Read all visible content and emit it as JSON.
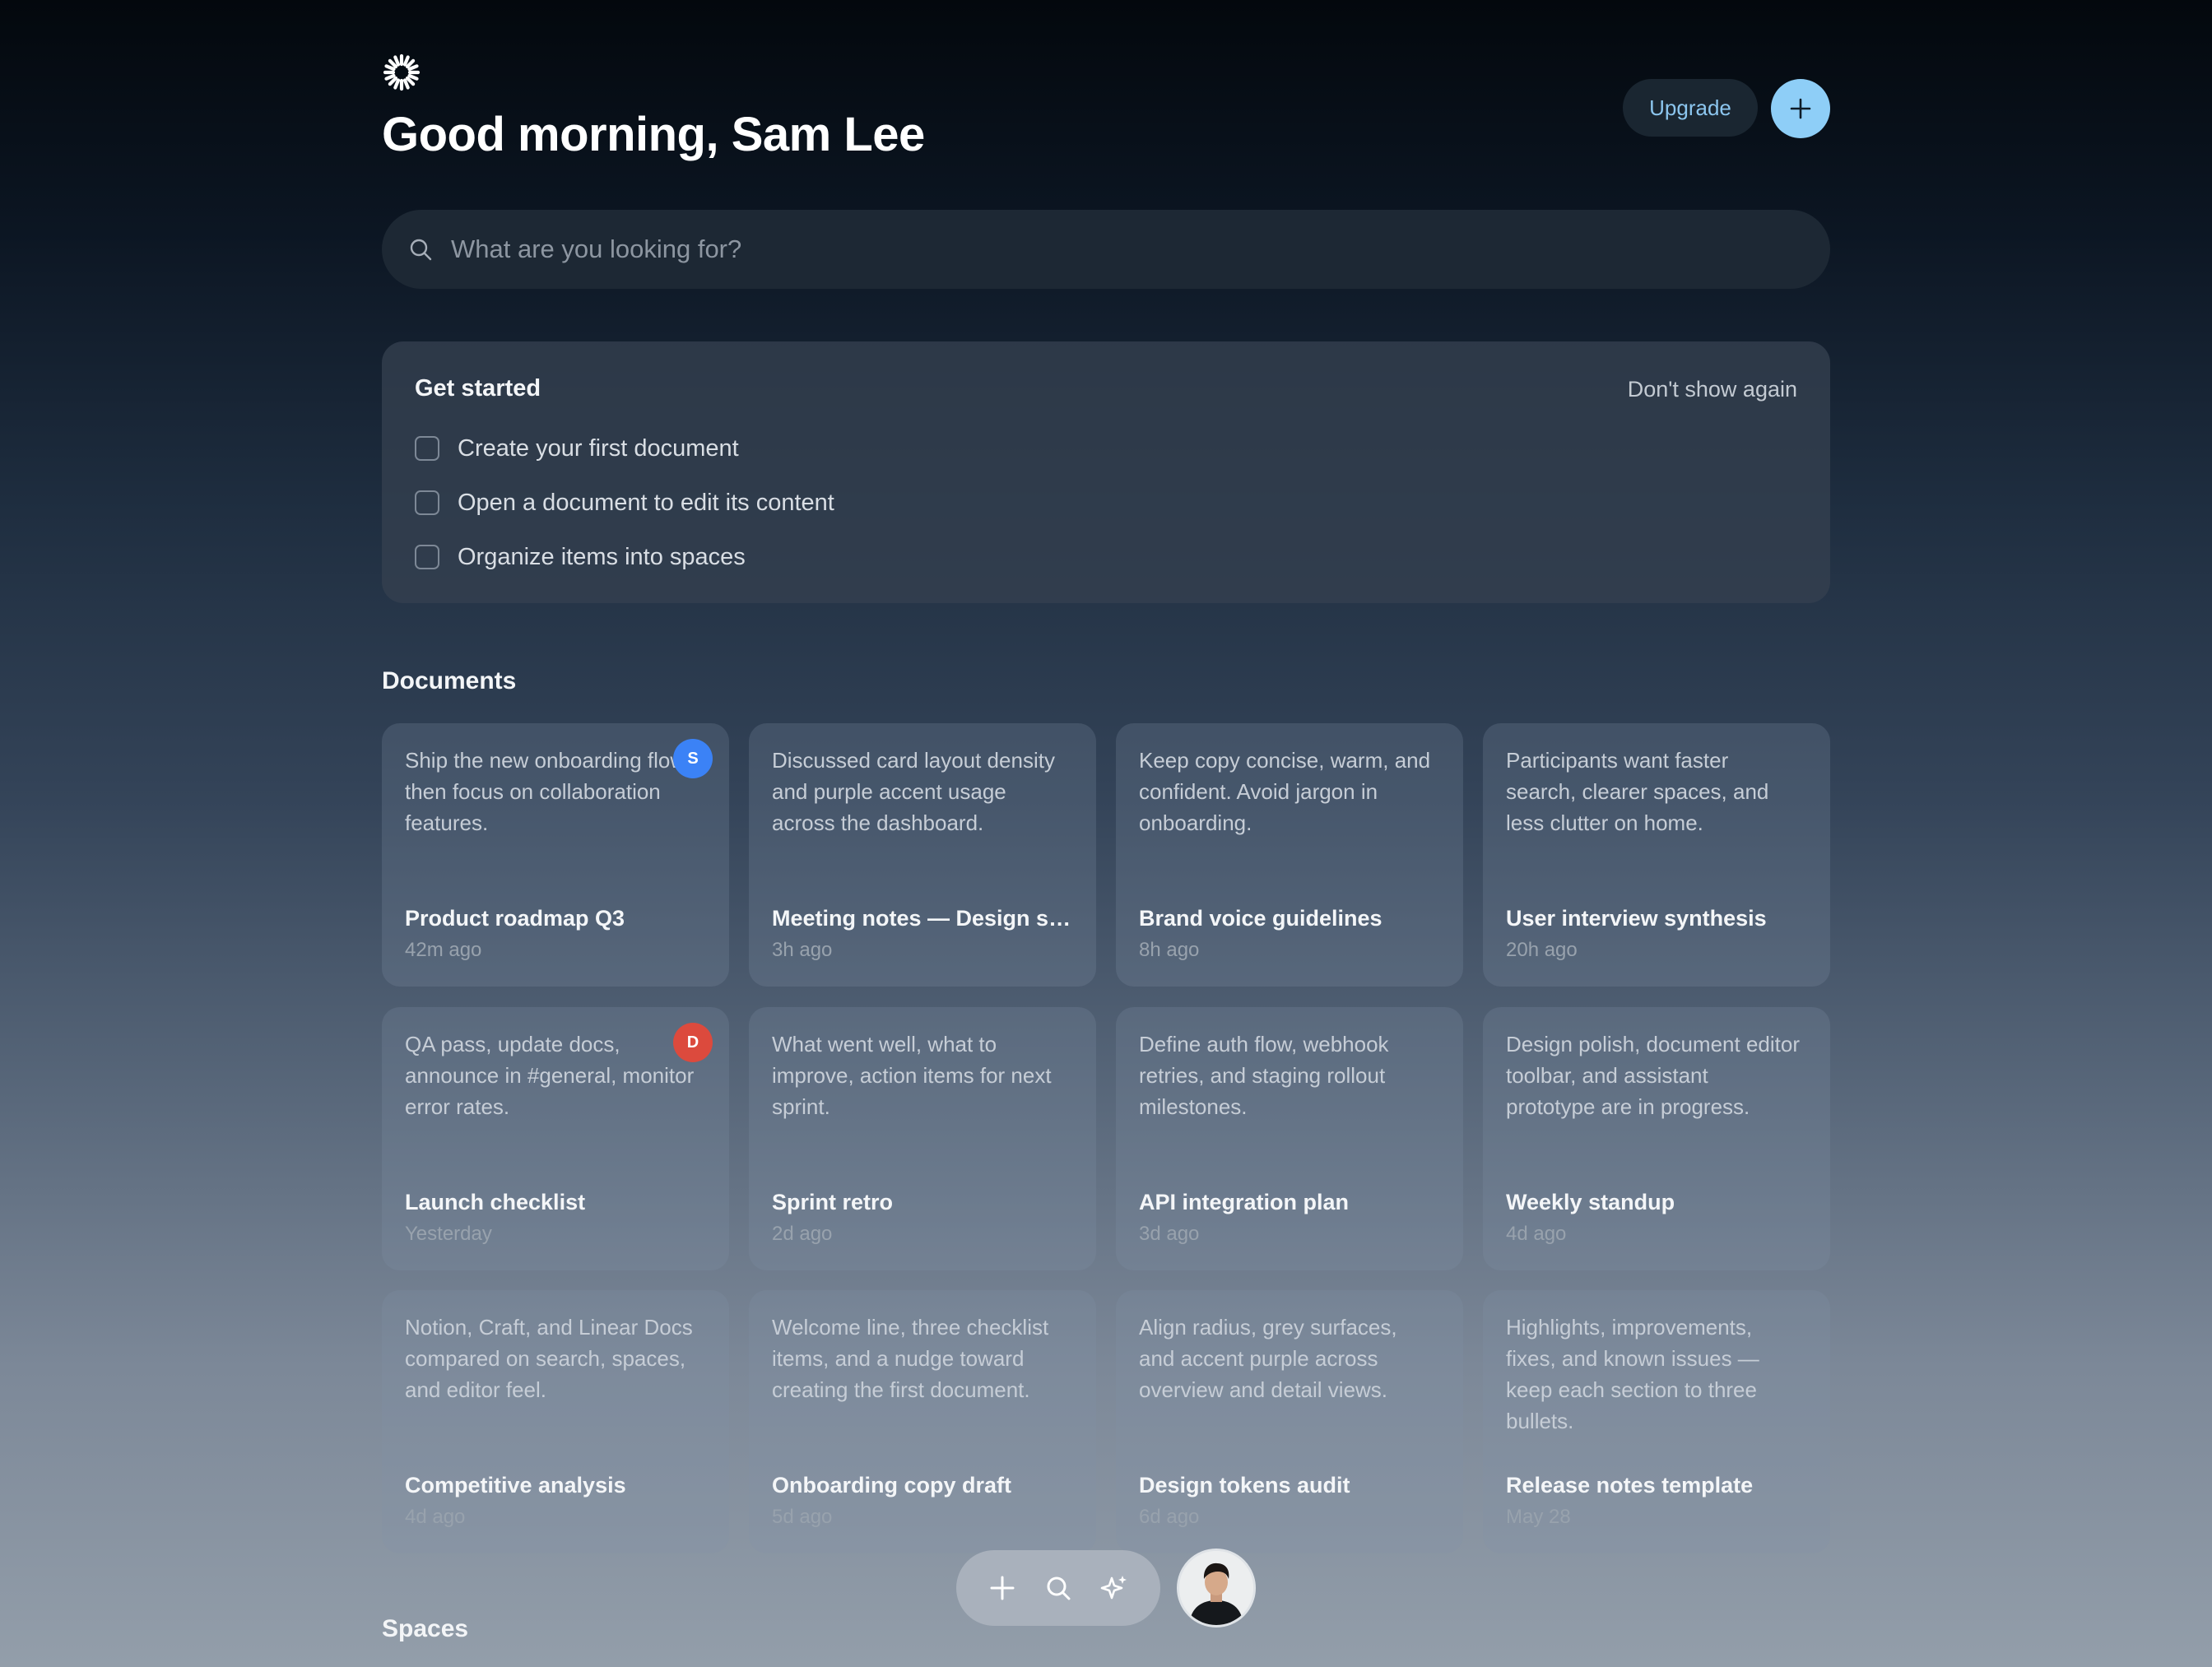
{
  "header": {
    "greeting": "Good morning, Sam Lee",
    "upgrade_label": "Upgrade"
  },
  "search": {
    "placeholder": "What are you looking for?"
  },
  "get_started": {
    "title": "Get started",
    "dismiss_label": "Don't show again",
    "items": [
      {
        "label": "Create your first document",
        "checked": false
      },
      {
        "label": "Open a document to edit its content",
        "checked": false
      },
      {
        "label": "Organize items into spaces",
        "checked": false
      }
    ]
  },
  "documents": {
    "title": "Documents",
    "cards": [
      {
        "snippet": "Ship the new onboarding flow, then focus on collaboration features.",
        "title": "Product roadmap Q3",
        "time": "42m ago",
        "avatar": {
          "initial": "S",
          "color": "#3b82f6"
        }
      },
      {
        "snippet": "Discussed card layout density and purple accent usage across the dashboard.",
        "title": "Meeting notes — Design sync",
        "time": "3h ago"
      },
      {
        "snippet": "Keep copy concise, warm, and confident. Avoid jargon in onboarding.",
        "title": "Brand voice guidelines",
        "time": "8h ago"
      },
      {
        "snippet": "Participants want faster search, clearer spaces, and less clutter on home.",
        "title": "User interview synthesis",
        "time": "20h ago"
      },
      {
        "snippet": "QA pass, update docs, announce in #general, monitor error rates.",
        "title": "Launch checklist",
        "time": "Yesterday",
        "avatar": {
          "initial": "D",
          "color": "#dc4a3d"
        }
      },
      {
        "snippet": "What went well, what to improve, action items for next sprint.",
        "title": "Sprint retro",
        "time": "2d ago"
      },
      {
        "snippet": "Define auth flow, webhook retries, and staging rollout milestones.",
        "title": "API integration plan",
        "time": "3d ago"
      },
      {
        "snippet": "Design polish, document editor toolbar, and assistant prototype are in progress.",
        "title": "Weekly standup",
        "time": "4d ago"
      },
      {
        "snippet": "Notion, Craft, and Linear Docs compared on search, spaces, and editor feel.",
        "title": "Competitive analysis",
        "time": "4d ago"
      },
      {
        "snippet": "Welcome line, three checklist items, and a nudge toward creating the first document.",
        "title": "Onboarding copy draft",
        "time": "5d ago"
      },
      {
        "snippet": "Align radius, grey surfaces, and accent purple across overview and detail views.",
        "title": "Design tokens audit",
        "time": "6d ago"
      },
      {
        "snippet": "Highlights, improvements, fixes, and known issues — keep each section to three bullets.",
        "title": "Release notes template",
        "time": "May 28"
      }
    ]
  },
  "spaces": {
    "title": "Spaces"
  },
  "dock": {
    "buttons": [
      "plus-icon",
      "search-icon",
      "sparkle-icon"
    ]
  },
  "colors": {
    "accent": "#8ecef7",
    "upgrade_text": "#8cc6ef"
  }
}
